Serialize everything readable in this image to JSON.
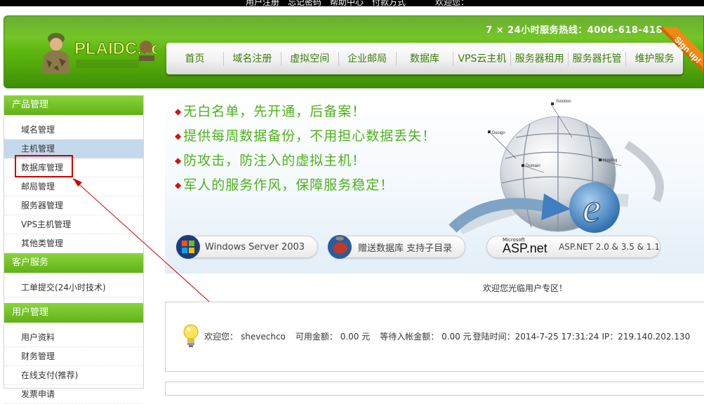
{
  "topbar": {
    "links": [
      "用户注册",
      "忘记密码",
      "帮助中心",
      "付款方式"
    ],
    "welcome": "欢迎您："
  },
  "header": {
    "logo_text": "PLAIDC.com",
    "hotline": "7 × 24小时服务热线：4006-618-418",
    "signup_ribbon": "Sign up!",
    "nav": [
      "首页",
      "域名注册",
      "虚拟空间",
      "企业邮局",
      "数据库",
      "VPS云主机",
      "服务器租用",
      "服务器托管",
      "维护服务"
    ]
  },
  "sidebar": {
    "sections": [
      {
        "title": "产品管理",
        "items": [
          "域名管理",
          "主机管理",
          "数据库管理",
          "邮局管理",
          "服务器管理",
          "VPS主机管理",
          "其他类管理"
        ],
        "active_index": 1
      },
      {
        "title": "客户服务",
        "items": [
          "工单提交(24小时技术)"
        ],
        "active_index": -1
      },
      {
        "title": "用户管理",
        "items": [
          "用户资料",
          "财务管理",
          "在线支付(推荐)",
          "发票申请"
        ],
        "active_index": -1
      }
    ]
  },
  "banner": {
    "slogans": [
      "无白名单，先开通，后备案！",
      "提供每周数据备份，不用担心数据丢失！",
      "防攻击，防注入的虚拟主机！",
      "军人的服务作风，保障服务稳定！"
    ],
    "globe_labels": [
      "Solution",
      "Design",
      "Domain",
      "Hosting"
    ],
    "badge_windows": "Windows Server 2003",
    "badge_database": "赠送数据库 支持子目录",
    "badge_aspnet_small": "Microsoft",
    "badge_aspnet_logo": "ASP.net",
    "badge_aspnet_versions": "ASP.NET 2.0 & 3.5 & 1.1"
  },
  "welcome_message": "欢迎您光临用户专区！",
  "account": {
    "greeting_label": "欢迎您：",
    "username": "shevechco",
    "balance": "可用金额：  0.00 元",
    "pending": "等待入帐金额：  0.00 元",
    "login_time": "登陆时间：2014-7-25 17:31:24",
    "ip": "IP：219.140.202.130"
  },
  "colors": {
    "header_green": "#58b00c",
    "nav_text": "#3a7d0a",
    "slogan_green": "#4db21a",
    "bullet_red": "#d31111",
    "annotation_red": "#cc0000",
    "ribbon_orange": "#f08a14"
  }
}
